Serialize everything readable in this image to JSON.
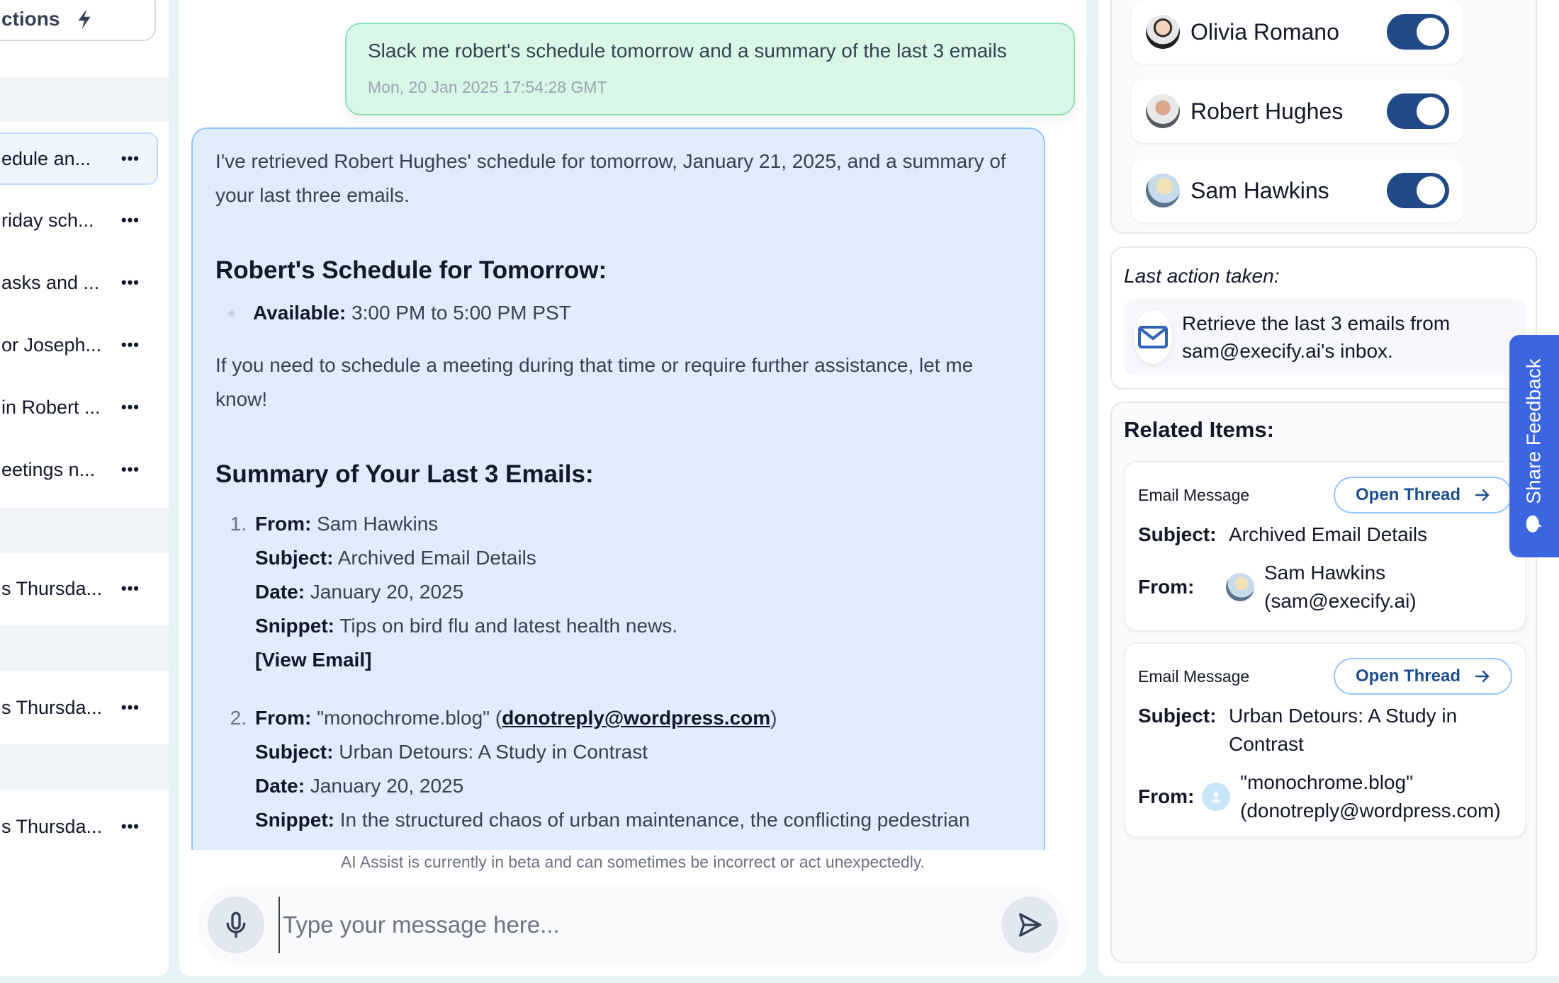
{
  "sidebar": {
    "actions_label": "ctions",
    "threads": [
      {
        "label": "edule an...",
        "active": true
      },
      {
        "label": "riday sch...",
        "active": false
      },
      {
        "label": "asks and ...",
        "active": false
      },
      {
        "label": "or Joseph...",
        "active": false
      },
      {
        "label": "in Robert ...",
        "active": false
      },
      {
        "label": "eetings n...",
        "active": false
      },
      {
        "label": "s Thursda...",
        "active": false
      },
      {
        "label": "s Thursda...",
        "active": false
      },
      {
        "label": "s Thursda...",
        "active": false
      }
    ],
    "more_label": "•••"
  },
  "chat": {
    "user_message": {
      "text": "Slack me robert's schedule tomorrow and a summary of the last 3 emails",
      "timestamp": "Mon, 20 Jan 2025 17:54:28 GMT"
    },
    "assistant_message": {
      "intro": "I've retrieved Robert Hughes' schedule for tomorrow, January 21, 2025, and a summary of your last three emails.",
      "schedule_heading": "Robert's Schedule for Tomorrow:",
      "schedule_items": [
        {
          "label": "Available:",
          "value": "3:00 PM to 5:00 PM PST"
        }
      ],
      "followup": "If you need to schedule a meeting during that time or require further assistance, let me know!",
      "emails_heading": "Summary of Your Last 3 Emails:",
      "emails": [
        {
          "num": "1.",
          "from_label": "From:",
          "from": "Sam Hawkins",
          "subject_label": "Subject:",
          "subject": "Archived Email Details",
          "date_label": "Date:",
          "date": "January 20, 2025",
          "snippet_label": "Snippet:",
          "snippet": "Tips on bird flu and latest health news.",
          "link": "[View Email]"
        },
        {
          "num": "2.",
          "from_label": "From:",
          "from_prefix": "\"monochrome.blog\" (",
          "from_link": "donotreply@wordpress.com",
          "from_suffix": ")",
          "subject_label": "Subject:",
          "subject": "Urban Detours: A Study in Contrast",
          "date_label": "Date:",
          "date": "January 20, 2025",
          "snippet_label": "Snippet:",
          "snippet": "In the structured chaos of urban maintenance, the conflicting pedestrian"
        }
      ]
    },
    "disclaimer": "AI Assist is currently in beta and can sometimes be incorrect or act unexpectedly.",
    "input": {
      "placeholder": "Type your message here...",
      "value": ""
    }
  },
  "right_panel": {
    "people": [
      {
        "name": "Olivia Romano",
        "enabled": true
      },
      {
        "name": "Robert Hughes",
        "enabled": true
      },
      {
        "name": "Sam Hawkins",
        "enabled": true
      }
    ],
    "last_action": {
      "title": "Last action taken:",
      "text": "Retrieve the last 3 emails from sam@execify.ai's inbox.",
      "icon": "mail-icon"
    },
    "related": {
      "title": "Related Items:",
      "items": [
        {
          "type": "Email Message",
          "button": "Open Thread",
          "subject_label": "Subject:",
          "subject": "Archived Email Details",
          "from_label": "From:",
          "from_name": "Sam Hawkins",
          "from_email": "(sam@execify.ai)"
        },
        {
          "type": "Email Message",
          "button": "Open Thread",
          "subject_label": "Subject:",
          "subject": "Urban Detours: A Study in Contrast",
          "from_label": "From:",
          "from_name": "\"monochrome.blog\"",
          "from_email": "(donotreply@wordpress.com)"
        }
      ]
    },
    "feedback_label": "Share Feedback"
  },
  "colors": {
    "toggle_on": "#1f4a85",
    "feedback_tab": "#3b66e0",
    "user_bubble": "#d9f7e6",
    "assistant_bubble": "#dfecfb"
  }
}
